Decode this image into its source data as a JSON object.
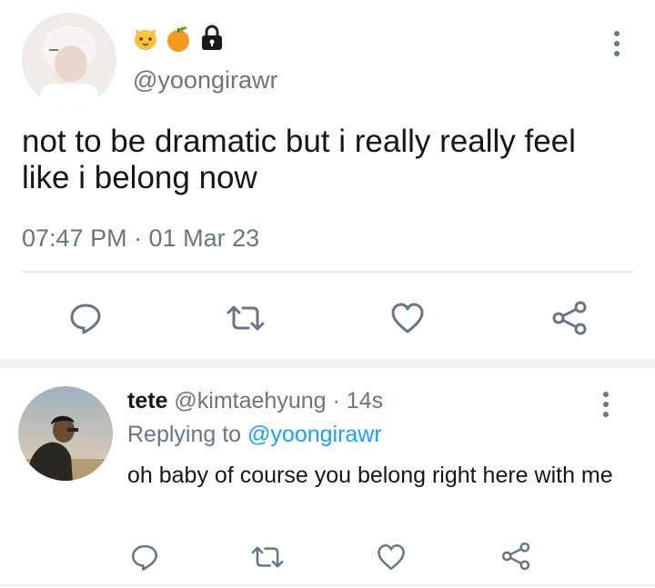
{
  "main_tweet": {
    "display_name_icons": [
      "cat-face-emoji-icon",
      "tangerine-emoji-icon",
      "lock-emoji-icon"
    ],
    "handle": "@yoongirawr",
    "text": "not to be dramatic but i really really feel like i belong now",
    "timestamp": "07:47 PM · 01 Mar 23",
    "actions": [
      "reply-icon",
      "retweet-icon",
      "like-icon",
      "share-icon"
    ]
  },
  "reply_tweet": {
    "name": "tete",
    "handle": "@kimtaehyung",
    "time": "· 14s",
    "replying_prefix": "Replying to",
    "replying_to": "@yoongirawr",
    "text": "oh baby of course you belong right here with me",
    "actions": [
      "reply-icon",
      "retweet-icon",
      "like-icon",
      "share-icon"
    ]
  },
  "colors": {
    "text": "#14171a",
    "secondary": "#657786",
    "link": "#1da1f2",
    "divider": "#e6ecf0"
  }
}
